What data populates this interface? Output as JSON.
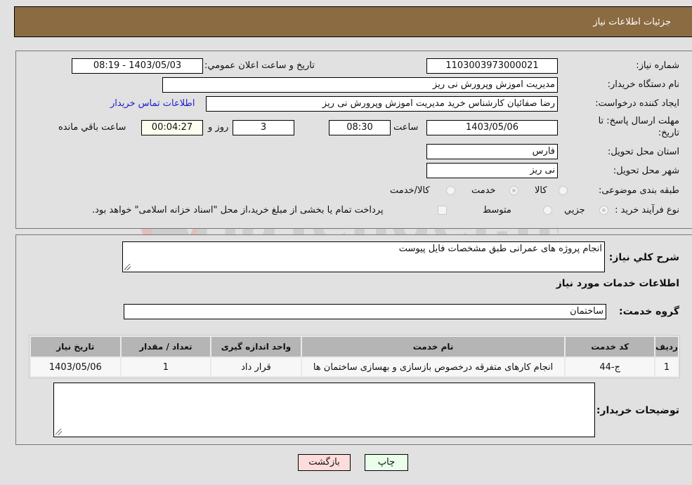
{
  "header": {
    "title": "جزئیات اطلاعات نیاز"
  },
  "details": {
    "need_number_label": "شماره نیاز:",
    "need_number": "1103003973000021",
    "announce_label": "تاریخ و ساعت اعلان عمومي:",
    "announce_value": "1403/05/03 - 08:19",
    "buyer_org_label": "نام دستگاه خریدار:",
    "buyer_org": "مدیریت اموزش وپرورش نی ریز",
    "creator_label": "ایجاد کننده درخواست:",
    "creator": "رضا صفائیان کارشناس خرید مدیریت اموزش وپرورش نی ریز",
    "contact_link": "اطلاعات تماس خریدار",
    "deadline_label_line1": "مهلت ارسال پاسخ: تا",
    "deadline_label_line2": "تاریخ:",
    "deadline_date": "1403/05/06",
    "time_label": "ساعت",
    "deadline_time": "08:30",
    "days_value": "3",
    "days_label": "روز و",
    "remaining_time": "00:04:27",
    "remaining_label": "ساعت باقي مانده",
    "province_label": "استان محل تحویل:",
    "province": "فارس",
    "city_label": "شهر محل تحویل:",
    "city": "نی ریز",
    "category_label": "طبقه بندی موضوعی:",
    "category_options": [
      {
        "label": "کالا",
        "checked": false
      },
      {
        "label": "خدمت",
        "checked": true
      },
      {
        "label": "کالا/خدمت",
        "checked": false
      }
    ],
    "process_label": "نوع فرآیند خرید :",
    "process_options": [
      {
        "label": "جزیي",
        "checked": true
      },
      {
        "label": "متوسط",
        "checked": false
      }
    ],
    "treasury_checkbox_label": "پرداخت تمام یا بخشی از مبلغ خرید،از محل \"اسناد خزانه اسلامی\" خواهد بود."
  },
  "services": {
    "summary_label": "شرح کلي نیاز:",
    "summary": "انجام پروژه های عمرانی طبق مشخصات فایل پیوست",
    "section_title": "اطلاعات خدمات مورد نیاز",
    "group_label": "گروه خدمت:",
    "group_value": "ساختمان",
    "table": {
      "headers": [
        "ردیف",
        "کد خدمت",
        "نام خدمت",
        "واحد اندازه گیری",
        "تعداد / مقدار",
        "تاریخ نیاز"
      ],
      "rows": [
        [
          "1",
          "ج-44",
          "انجام کارهای متفرقه درخصوص بازسازی و بهسازی ساختمان ها",
          "قرار داد",
          "1",
          "1403/05/06"
        ]
      ]
    },
    "buyer_notes_label": "توضیحات خریدار:",
    "buyer_notes": ""
  },
  "buttons": {
    "print": "چاپ",
    "back": "بازگشت"
  },
  "watermark": {
    "text": "AriaTender.neT"
  }
}
